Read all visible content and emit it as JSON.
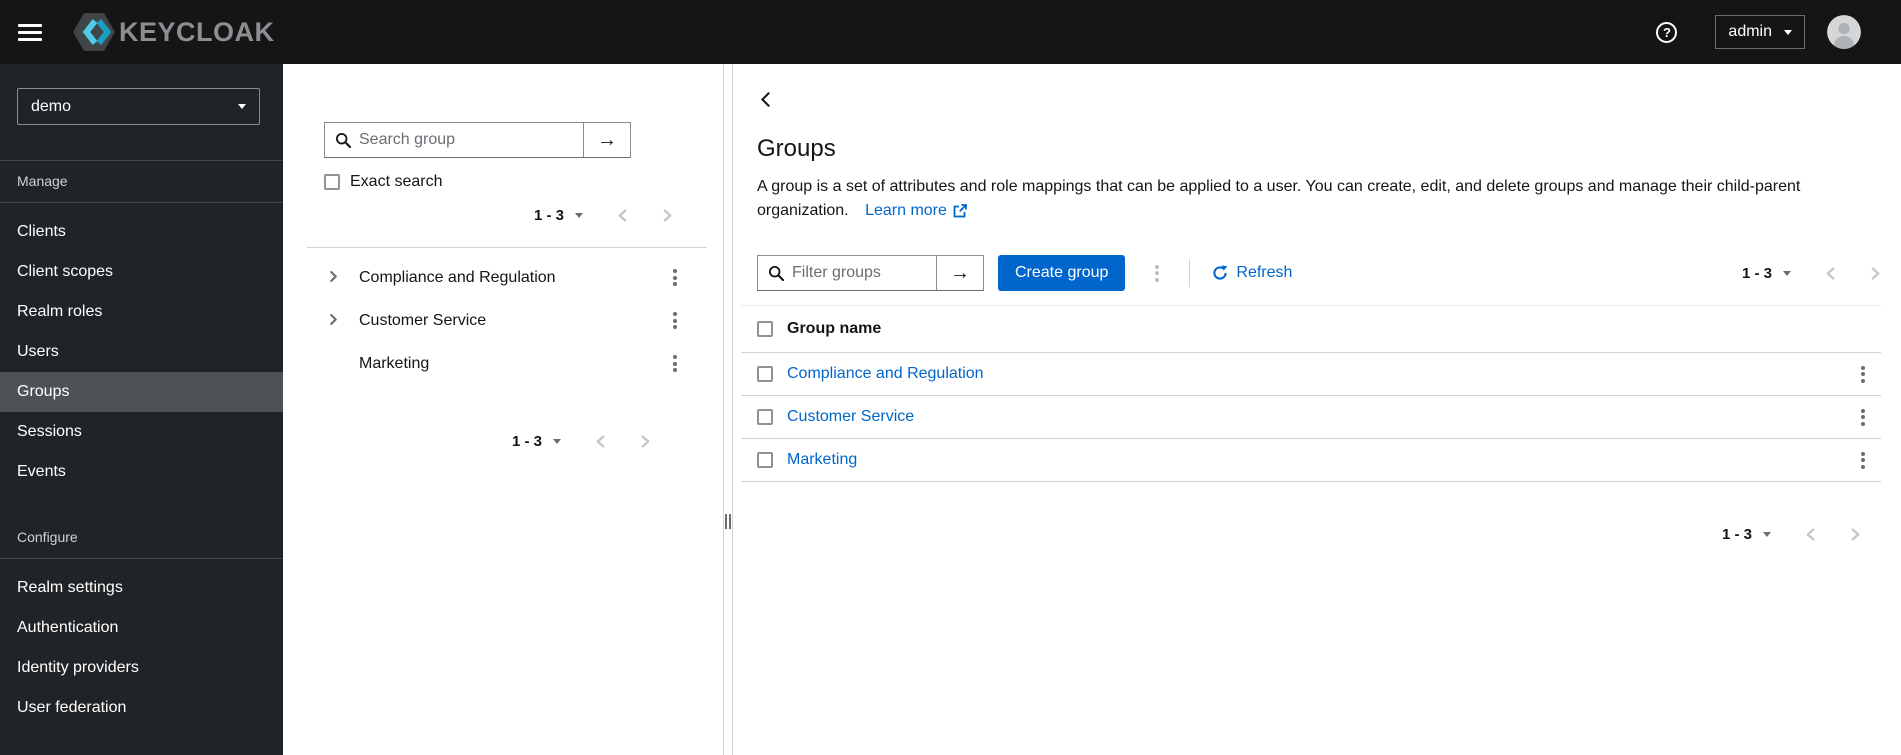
{
  "topbar": {
    "brand": "KEYCLOAK",
    "username": "admin"
  },
  "sidebar": {
    "realm": "demo",
    "manage_label": "Manage",
    "configure_label": "Configure",
    "manage_items": {
      "clients": "Clients",
      "client_scopes": "Client scopes",
      "realm_roles": "Realm roles",
      "users": "Users",
      "groups": "Groups",
      "sessions": "Sessions",
      "events": "Events"
    },
    "configure_items": {
      "realm_settings": "Realm settings",
      "authentication": "Authentication",
      "identity_providers": "Identity providers",
      "user_federation": "User federation"
    },
    "selected_item": "Groups"
  },
  "tree_panel": {
    "search_placeholder": "Search group",
    "exact_search_label": "Exact search",
    "pagination_top": "1 - 3",
    "pagination_bottom": "1 - 3",
    "groups": [
      {
        "name": "Compliance and Regulation",
        "expandable": true
      },
      {
        "name": "Customer Service",
        "expandable": true
      },
      {
        "name": "Marketing",
        "expandable": false
      }
    ]
  },
  "main": {
    "title": "Groups",
    "description": "A group is a set of attributes and role mappings that can be applied to a user. You can create, edit, and delete groups and manage their child-parent organization.",
    "learn_more_label": "Learn more",
    "toolbar": {
      "filter_placeholder": "Filter groups",
      "create_button": "Create group",
      "refresh_label": "Refresh",
      "pagination": "1 - 3"
    },
    "table": {
      "column_header": "Group name",
      "rows": [
        {
          "name": "Compliance and Regulation"
        },
        {
          "name": "Customer Service"
        },
        {
          "name": "Marketing"
        }
      ]
    },
    "pagination_bottom": "1 - 3"
  },
  "colors": {
    "primary": "#0066cc",
    "link": "#0066cc",
    "masthead_bg": "#151515",
    "sidebar_bg": "#212427",
    "sidebar_selected": "#4f5255",
    "brand_text": "#8b8e92",
    "brand_cyan_light": "#50cbe5",
    "brand_cyan_dark": "#1e9ec2",
    "disabled_chevron": "#c5c7c9"
  }
}
